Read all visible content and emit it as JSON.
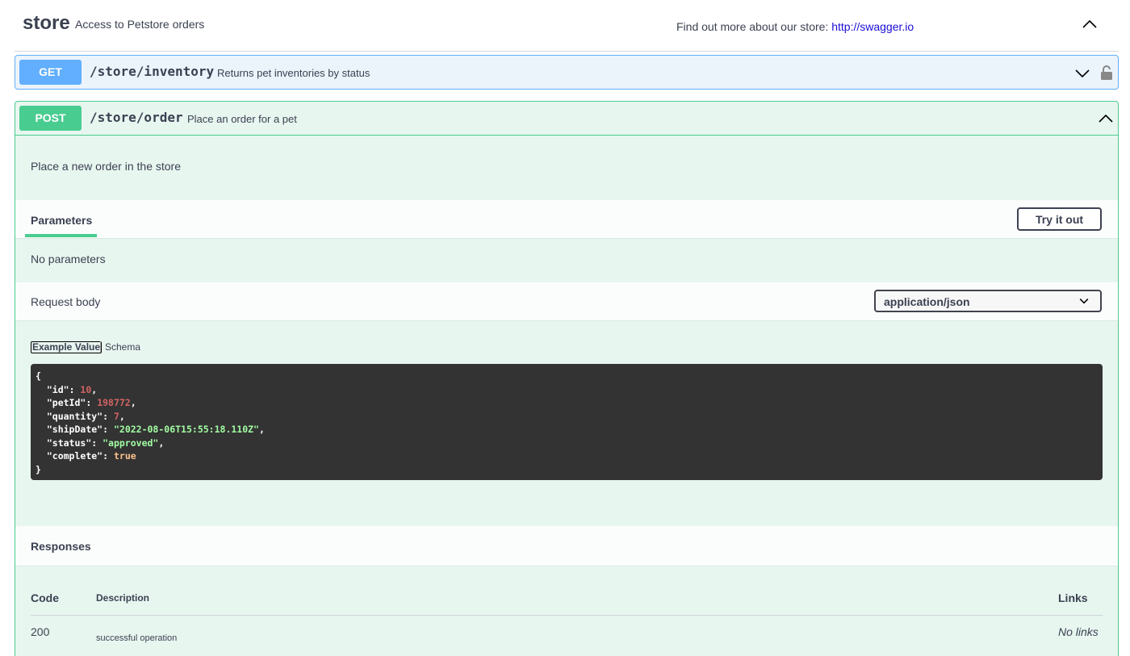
{
  "tag": {
    "name": "store",
    "description": "Access to Petstore orders",
    "external_text": "Find out more about our store:",
    "external_link": "http://swagger.io"
  },
  "operations": {
    "get": {
      "method": "GET",
      "path": "/store/inventory",
      "summary": "Returns pet inventories by status",
      "icons": [
        "chevron-down-icon",
        "lock-icon"
      ]
    },
    "post": {
      "method": "POST",
      "path": "/store/order",
      "summary": "Place an order for a pet",
      "description": "Place a new order in the store",
      "parameters_tab": "Parameters",
      "try_button": "Try it out",
      "no_parameters": "No parameters",
      "request_body_label": "Request body",
      "content_type": "application/json",
      "example_tab": "Example Value",
      "schema_tab": "Schema",
      "example": {
        "open": "{",
        "id_key": "\"id\"",
        "id_val": "10",
        "petId_key": "\"petId\"",
        "petId_val": "198772",
        "quantity_key": "\"quantity\"",
        "quantity_val": "7",
        "shipDate_key": "\"shipDate\"",
        "shipDate_val": "\"2022-08-06T15:55:18.110Z\"",
        "status_key": "\"status\"",
        "status_val": "\"approved\"",
        "complete_key": "\"complete\"",
        "complete_val": "true",
        "close": "}"
      },
      "responses": {
        "title": "Responses",
        "headers": {
          "code": "Code",
          "description": "Description",
          "links": "Links"
        },
        "rows": [
          {
            "code": "200",
            "description": "successful operation",
            "links": "No links"
          }
        ]
      }
    }
  },
  "colors": {
    "get": "#61affe",
    "post": "#49cc90",
    "link": "#1a0dd6",
    "code_bg": "#333333"
  }
}
